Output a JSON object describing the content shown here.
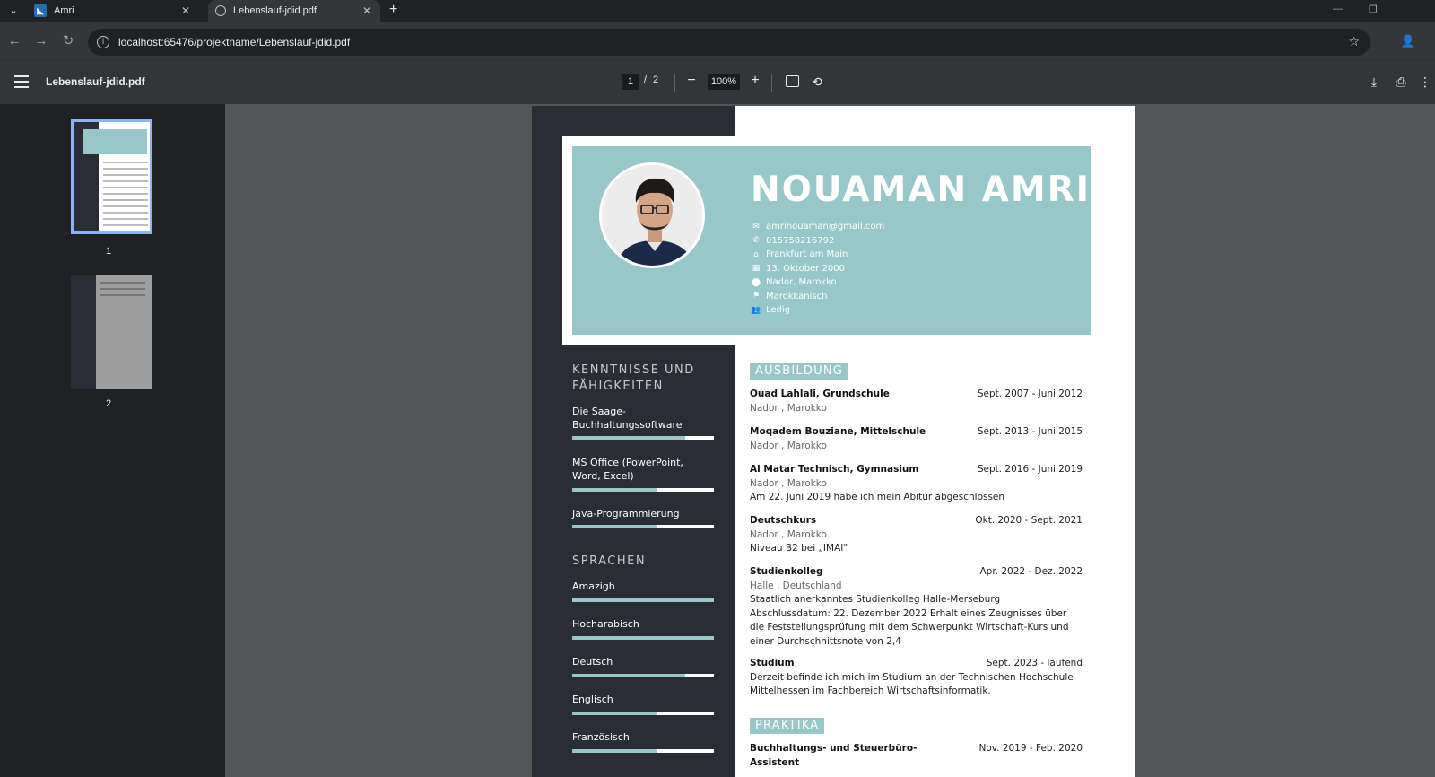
{
  "browser": {
    "tabs": [
      {
        "title": "Amri",
        "active": false
      },
      {
        "title": "Lebenslauf-jdid.pdf",
        "active": true
      }
    ],
    "url_host": "localhost",
    "url_rest": ":65476/projektname/Lebenslauf-jdid.pdf"
  },
  "pdf_toolbar": {
    "file_name": "Lebenslauf-jdid.pdf",
    "current_page": "1",
    "page_separator": "/",
    "total_pages": "2",
    "zoom": "100%"
  },
  "thumbnails": [
    {
      "label": "1",
      "selected": true
    },
    {
      "label": "2",
      "selected": false
    }
  ],
  "cv": {
    "name": "NOUAMAN AMRI",
    "contacts": [
      {
        "icon": "mail-icon",
        "glyph": "✉",
        "text": "amrinouaman@gmail.com"
      },
      {
        "icon": "phone-icon",
        "glyph": "✆",
        "text": "015758216792"
      },
      {
        "icon": "home-icon",
        "glyph": "⌂",
        "text": "Frankfurt am Main"
      },
      {
        "icon": "calendar-icon",
        "glyph": "▦",
        "text": "13. Oktober 2000"
      },
      {
        "icon": "location-pin-icon",
        "glyph": "⬤",
        "text": "Nador, Marokko"
      },
      {
        "icon": "flag-icon",
        "glyph": "⚑",
        "text": "Marokkanisch"
      },
      {
        "icon": "people-icon",
        "glyph": "👥",
        "text": "Ledig"
      }
    ],
    "skills_title_1": "KENNTNISSE UND",
    "skills_title_2": "FÄHIGKEITEN",
    "skills": [
      {
        "label": "Die Saage-Buchhaltungssoftware",
        "level": 0.8
      },
      {
        "label": "MS Office (PowerPoint, Word, Excel)",
        "level": 0.6
      },
      {
        "label": "Java-Programmierung",
        "level": 0.6
      }
    ],
    "languages_title": "SPRACHEN",
    "languages": [
      {
        "label": "Amazigh",
        "level": 1.0
      },
      {
        "label": "Hocharabisch",
        "level": 1.0
      },
      {
        "label": "Deutsch",
        "level": 0.8
      },
      {
        "label": "Englisch",
        "level": 0.6
      },
      {
        "label": "Französisch",
        "level": 0.6
      }
    ],
    "education_title": "AUSBILDUNG",
    "education": [
      {
        "institution": "Ouad Lahlali, Grundschule",
        "date": "Sept. 2007 - Juni 2012",
        "location": "Nador , Marokko",
        "notes": ""
      },
      {
        "institution": "Moqadem Bouziane, Mittelschule",
        "date": "Sept. 2013 - Juni 2015",
        "location": "Nador , Marokko",
        "notes": ""
      },
      {
        "institution": "Al Matar Technisch, Gymnasium",
        "date": "Sept. 2016 - Juni 2019",
        "location": "Nador , Marokko",
        "notes": "Am 22. Juni 2019 habe ich mein Abitur abgeschlossen"
      },
      {
        "institution": "Deutschkurs",
        "date": "Okt. 2020 - Sept. 2021",
        "location": "Nador , Marokko",
        "notes": "Niveau B2 bei „IMAI\""
      },
      {
        "institution": "Studienkolleg",
        "date": "Apr. 2022 - Dez. 2022",
        "location": "Halle , Deutschland",
        "notes": "Staatlich anerkanntes Studienkolleg Halle-Merseburg Abschlussdatum: 22. Dezember 2022 Erhalt eines Zeugnisses über die Feststellungsprüfung mit dem Schwerpunkt Wirtschaft-Kurs und einer Durchschnittsnote von 2,4"
      },
      {
        "institution": "Studium",
        "date": "Sept. 2023 - laufend",
        "location": "",
        "notes": "Derzeit befinde ich mich im Studium an der Technischen Hochschule Mittelhessen im Fachbereich Wirtschaftsinformatik."
      }
    ],
    "internships_title": "PRAKTIKA",
    "internships": [
      {
        "institution": "Buchhaltungs- und Steuerbüro-Assistent",
        "date": "Nov. 2019 - Feb. 2020"
      }
    ]
  },
  "colors": {
    "accent": "#97c7c8",
    "sidebar_dark": "#2a2d35",
    "viewer_bg": "#525659"
  }
}
